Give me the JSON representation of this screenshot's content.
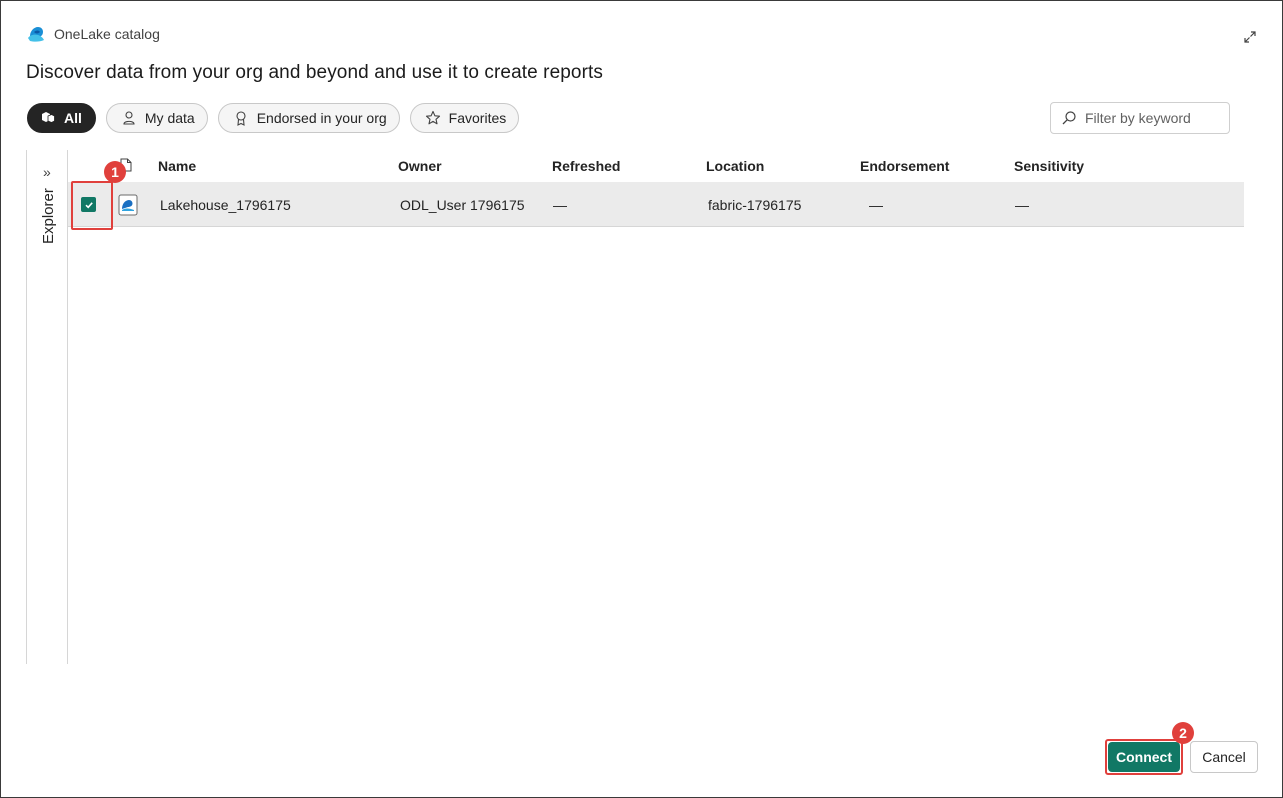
{
  "app": {
    "title": "OneLake catalog"
  },
  "page": {
    "heading": "Discover data from your org and beyond and use it to create reports"
  },
  "filters": [
    {
      "label": "All",
      "icon": "cubes-icon",
      "active": true
    },
    {
      "label": "My data",
      "icon": "person-icon",
      "active": false
    },
    {
      "label": "Endorsed in your org",
      "icon": "ribbon-icon",
      "active": false
    },
    {
      "label": "Favorites",
      "icon": "star-icon",
      "active": false
    }
  ],
  "search": {
    "placeholder": "Filter by keyword"
  },
  "explorer": {
    "label": "Explorer"
  },
  "table": {
    "columns": [
      "Name",
      "Owner",
      "Refreshed",
      "Location",
      "Endorsement",
      "Sensitivity"
    ],
    "rows": [
      {
        "name": "Lakehouse_1796175",
        "owner": "ODL_User 1796175",
        "refreshed": "—",
        "location": "fabric-1796175",
        "endorsement": "—",
        "sensitivity": "—",
        "selected": true
      }
    ]
  },
  "annotations": {
    "step1": "1",
    "step2": "2"
  },
  "actions": {
    "connect": "Connect",
    "cancel": "Cancel"
  },
  "colors": {
    "accent": "#117865",
    "highlight": "#e0403c",
    "active_pill": "#242424"
  }
}
